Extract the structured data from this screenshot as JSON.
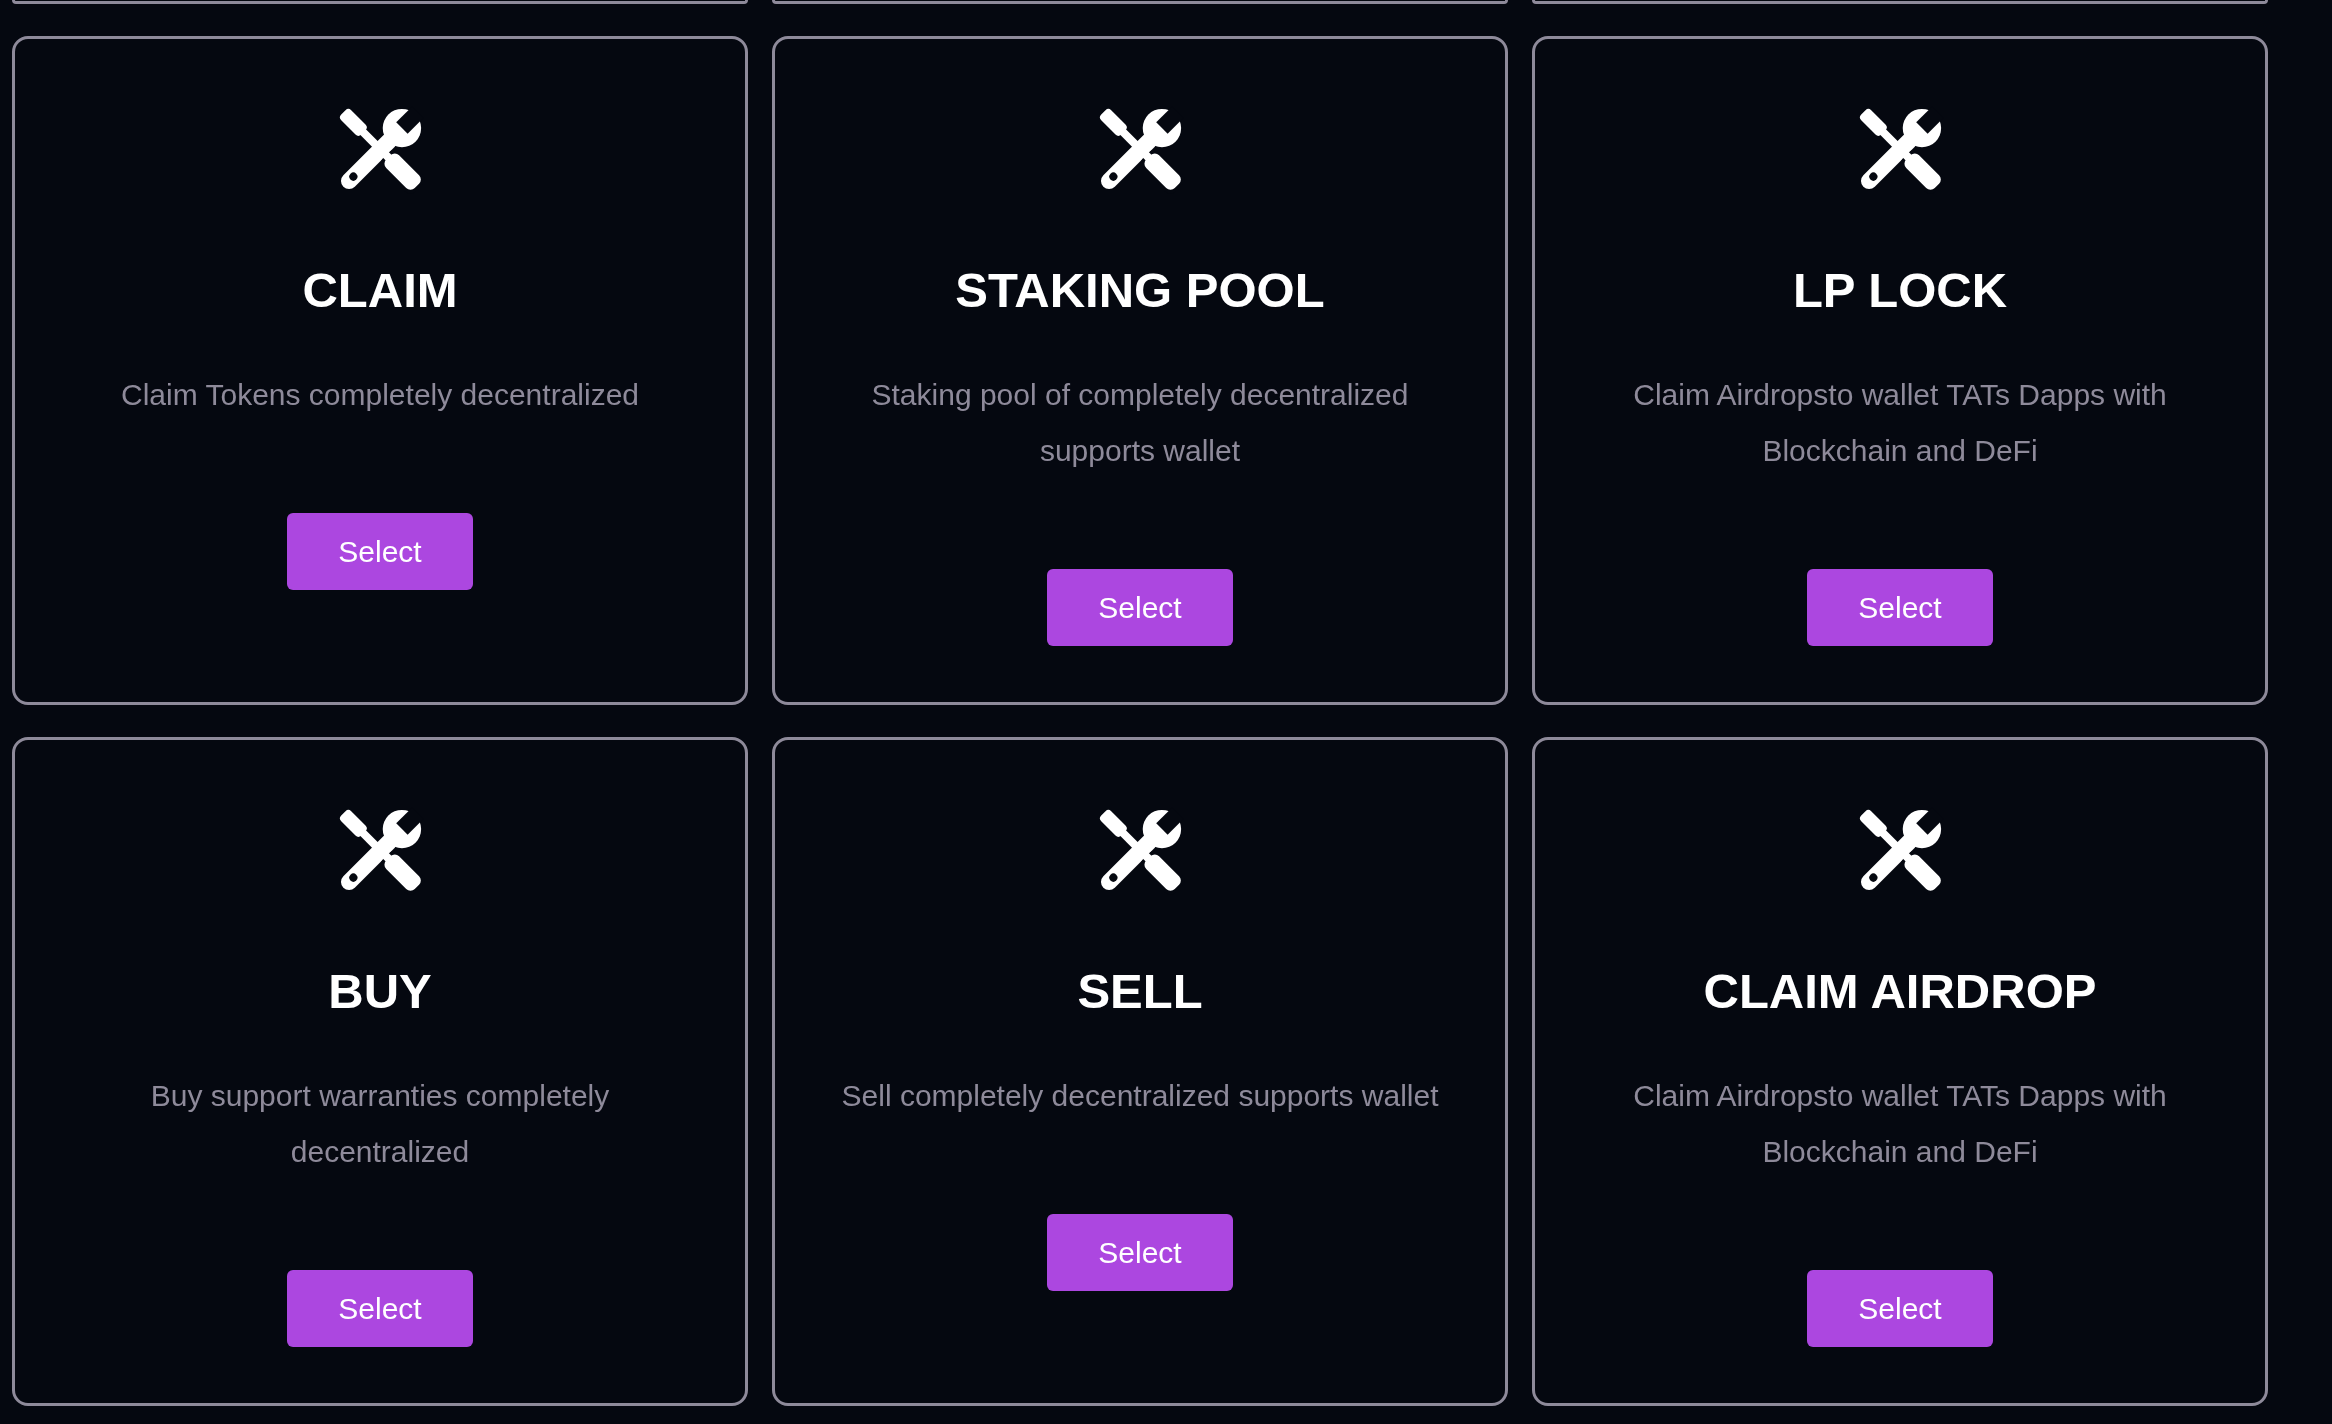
{
  "cards": [
    {
      "title": "CLAIM",
      "description": "Claim Tokens completely decentralized",
      "button": "Select"
    },
    {
      "title": "STAKING POOL",
      "description": "Staking pool of completely decentralized supports wallet",
      "button": "Select"
    },
    {
      "title": "LP LOCK",
      "description": "Claim Airdropsto wallet TATs Dapps with Blockchain and DeFi",
      "button": "Select"
    },
    {
      "title": "BUY",
      "description": "Buy support warranties completely decentralized",
      "button": "Select"
    },
    {
      "title": "SELL",
      "description": "Sell completely decentralized supports wallet",
      "button": "Select"
    },
    {
      "title": "CLAIM AIRDROP",
      "description": "Claim Airdropsto wallet TATs Dapps with Blockchain and DeFi",
      "button": "Select"
    }
  ]
}
